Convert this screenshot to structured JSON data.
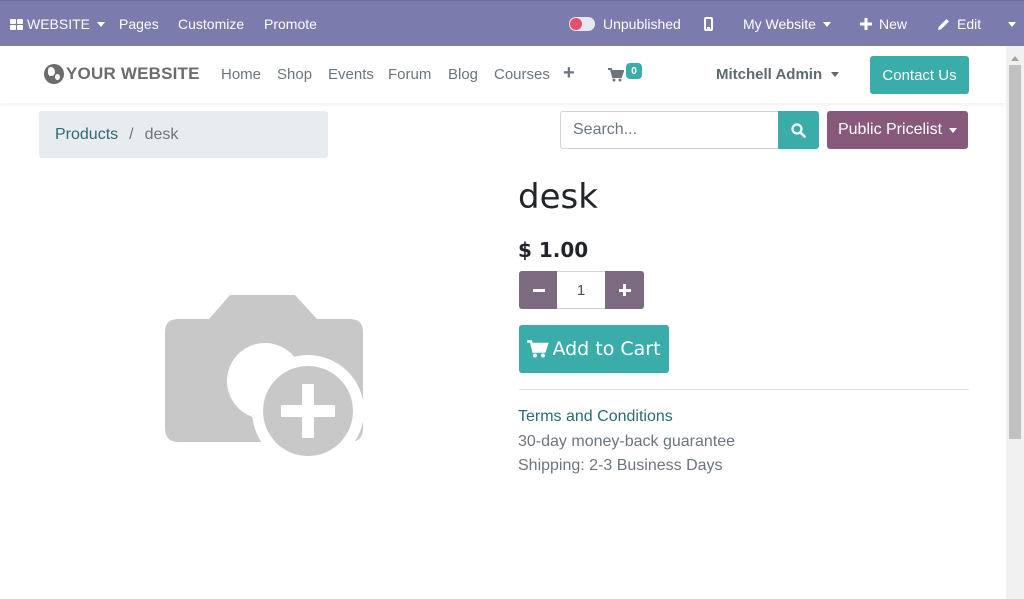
{
  "admin_bar": {
    "website_menu": "WEBSITE",
    "pages": "Pages",
    "customize": "Customize",
    "promote": "Promote",
    "publish_status": "Unpublished",
    "my_website": "My Website",
    "new": "New",
    "edit": "Edit",
    "color": "#7c7bad"
  },
  "header": {
    "logo_text": "YOUR WEBSITE",
    "nav": [
      "Home",
      "Shop",
      "Events",
      "Forum",
      "Blog",
      "Courses"
    ],
    "cart_count": "0",
    "user": "Mitchell Admin",
    "contact_button": "Contact Us"
  },
  "breadcrumb": {
    "parent": "Products",
    "separator": "/",
    "current": "desk"
  },
  "search": {
    "placeholder": "Search...",
    "pricelist": "Public Pricelist"
  },
  "product": {
    "name": "desk",
    "price": "$ 1.00",
    "quantity": "1",
    "add_to_cart": "Add to Cart",
    "terms": "Terms and Conditions",
    "guarantee": "30-day money-back guarantee",
    "shipping": "Shipping: 2-3 Business Days"
  },
  "icons": {
    "website": "grid-icon",
    "publish": "toggle-icon",
    "mobile": "mobile-icon",
    "new": "plus-icon",
    "edit": "pencil-icon",
    "logo": "globe-icon",
    "nav_add": "plus-icon",
    "cart": "cart-icon",
    "search": "search-icon",
    "image": "camera-add-icon"
  },
  "colors": {
    "primary": "#3aadaa",
    "secondary": "#875a7b",
    "qty_button": "#7b6a80",
    "link": "#2b6b71"
  }
}
